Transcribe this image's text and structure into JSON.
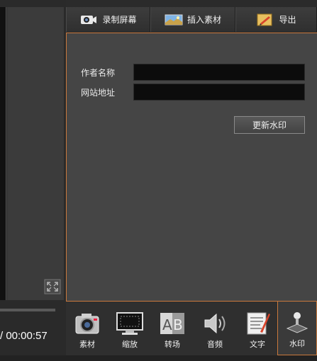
{
  "player": {
    "time_display": "/ 00:00:57"
  },
  "tabs": [
    {
      "label": "录制屏幕",
      "icon": "camera-icon"
    },
    {
      "label": "插入素材",
      "icon": "landscape-icon"
    },
    {
      "label": "导出",
      "icon": "pencil-export-icon"
    }
  ],
  "watermark": {
    "author_label": "作者名称",
    "author_value": "",
    "website_label": "网站地址",
    "website_value": "",
    "update_button": "更新水印"
  },
  "toolbar": [
    {
      "label": "素材",
      "icon": "camera-icon"
    },
    {
      "label": "缩放",
      "icon": "monitor-icon"
    },
    {
      "label": "转场",
      "icon": "ab-transition-icon"
    },
    {
      "label": "音频",
      "icon": "speaker-icon"
    },
    {
      "label": "文字",
      "icon": "text-document-icon"
    },
    {
      "label": "水印",
      "icon": "joystick-icon"
    }
  ],
  "colors": {
    "accent": "#c9783c",
    "panel": "#454545",
    "field": "#0c0c0c"
  }
}
